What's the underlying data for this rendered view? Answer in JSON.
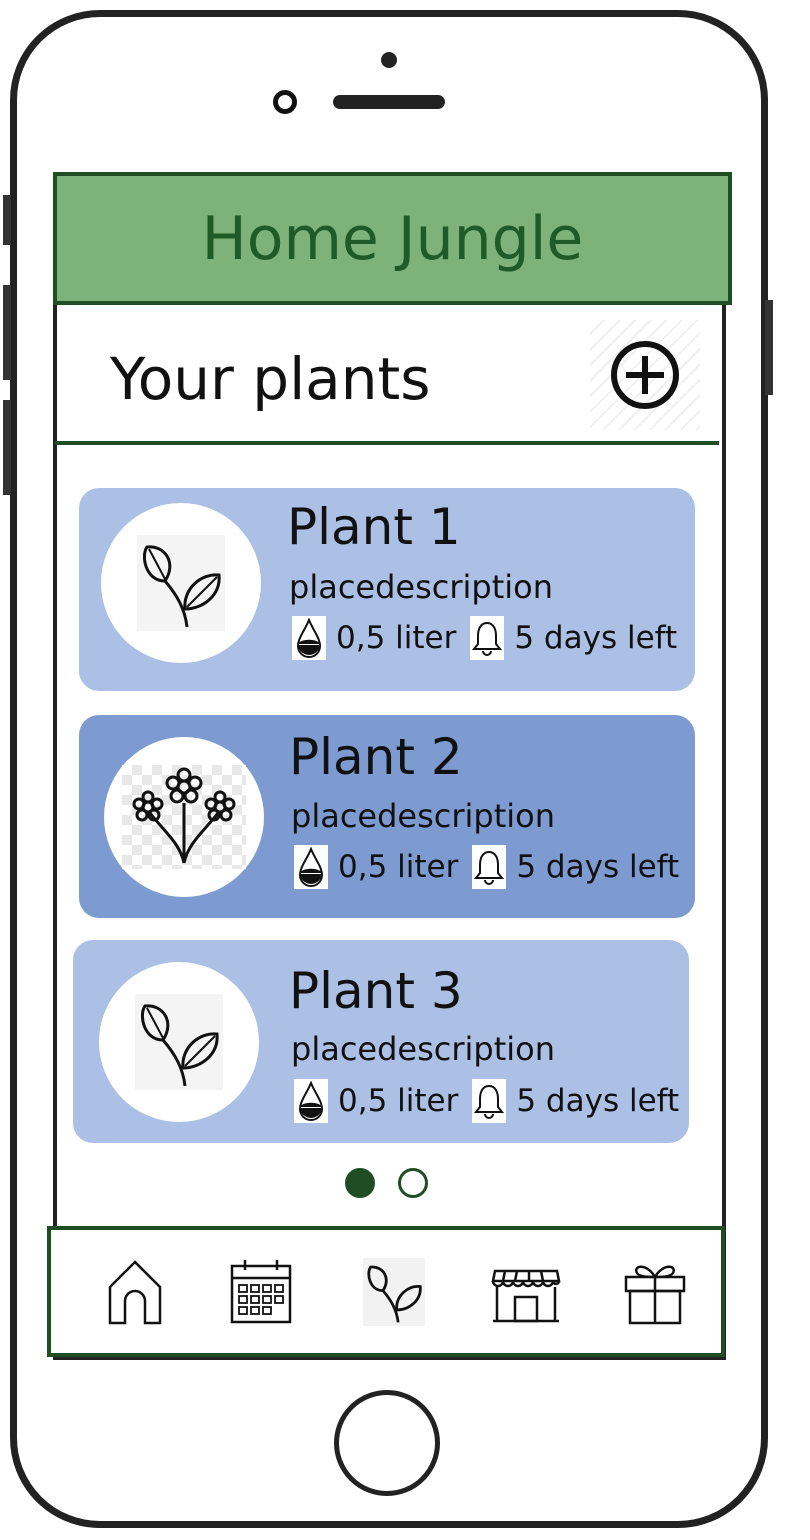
{
  "header": {
    "title": "Home Jungle",
    "color": "#7db37a"
  },
  "section": {
    "title": "Your plants",
    "add_icon": "plus-circle-icon"
  },
  "plants": [
    {
      "name": "Plant 1",
      "place": "placedescription",
      "water": "0,5 liter",
      "reminder": "5 days left",
      "icon": "sprout-icon",
      "bg": "#abc0e4"
    },
    {
      "name": "Plant 2",
      "place": "placedescription",
      "water": "0,5 liter",
      "reminder": "5 days left",
      "icon": "flowers-icon",
      "bg": "#7d9bd0"
    },
    {
      "name": "Plant 3",
      "place": "placedescription",
      "water": "0,5 liter",
      "reminder": "5 days left",
      "icon": "sprout-icon",
      "bg": "#abc0e4"
    }
  ],
  "pagination": {
    "pages": 2,
    "current": 1
  },
  "nav": [
    {
      "name": "home",
      "icon": "home-icon"
    },
    {
      "name": "calendar",
      "icon": "calendar-icon"
    },
    {
      "name": "plants",
      "icon": "sprout-icon"
    },
    {
      "name": "shop",
      "icon": "shop-icon"
    },
    {
      "name": "gifts",
      "icon": "gift-icon"
    }
  ]
}
